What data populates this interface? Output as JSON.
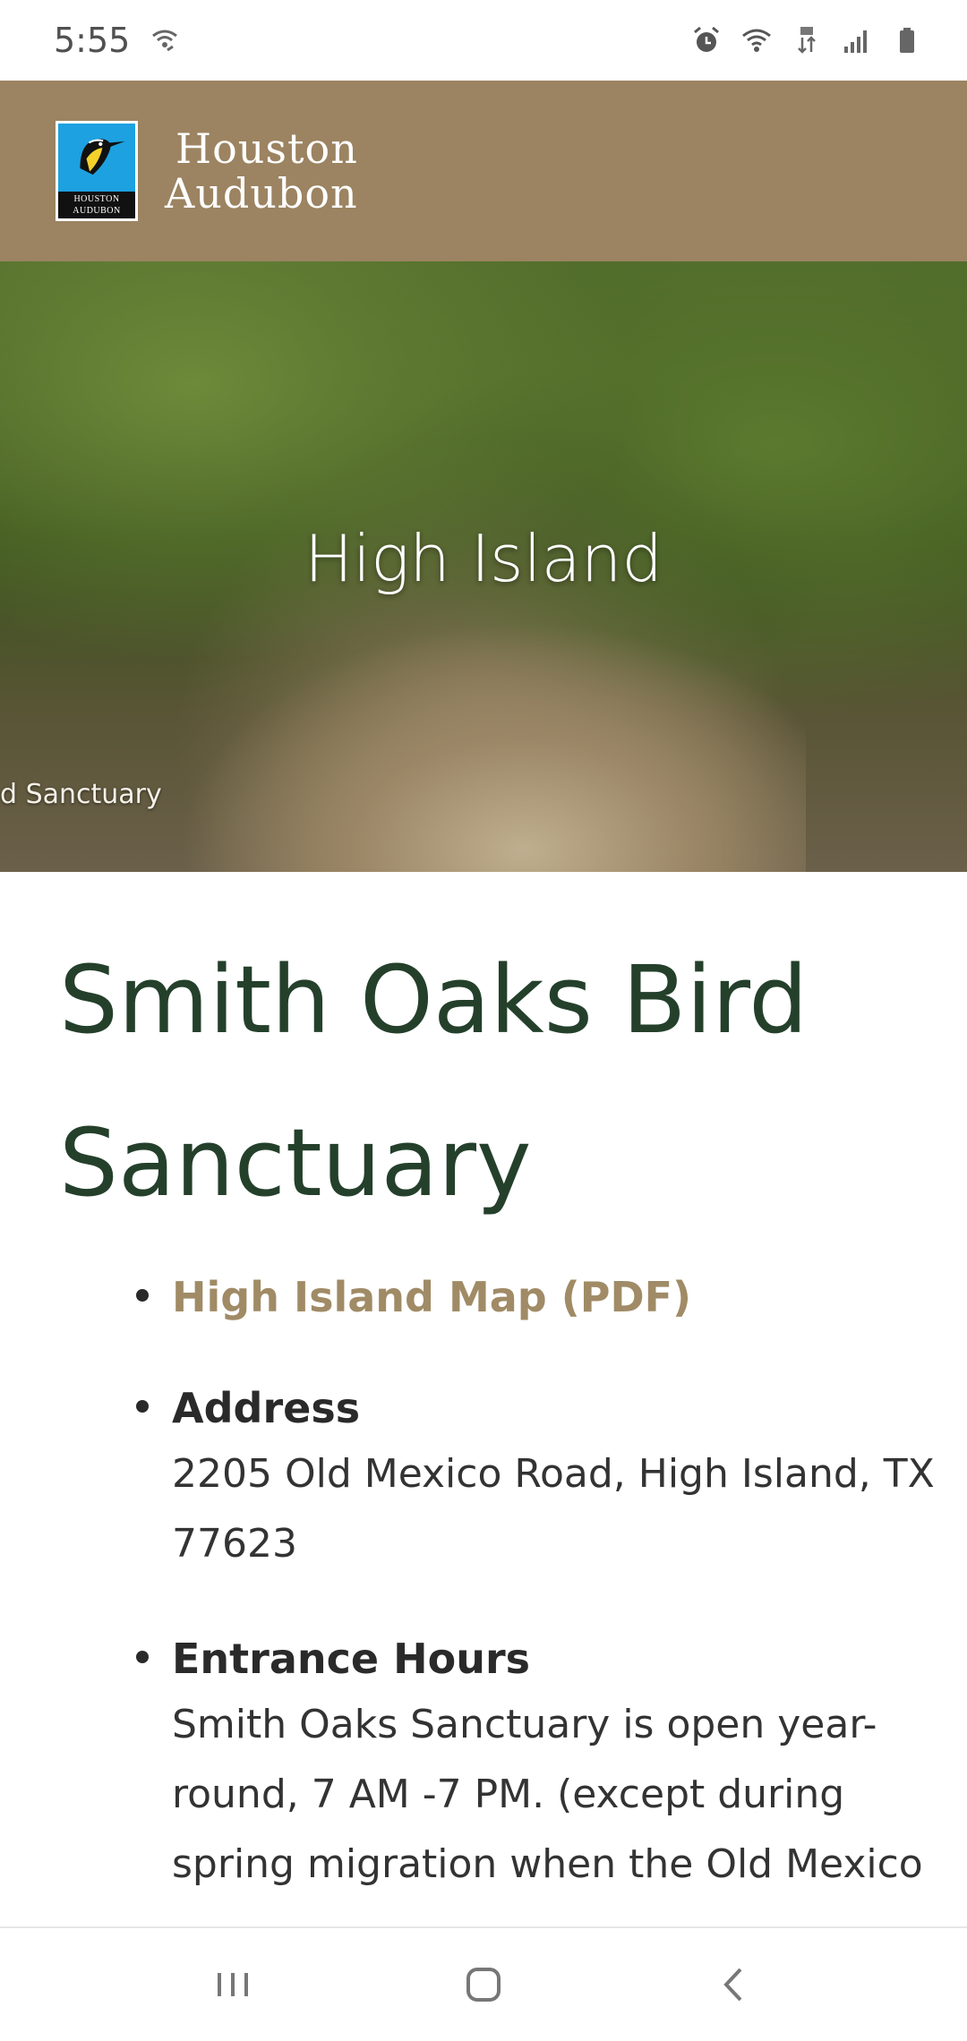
{
  "status_bar": {
    "time": "5:55"
  },
  "header": {
    "logo_line1": "Houston",
    "logo_line2": "Audubon",
    "logo_badge_top": "HOUSTON",
    "logo_badge_bottom": "AUDUBON"
  },
  "hero": {
    "title": "High Island",
    "sign_text": "d Sanctuary"
  },
  "main": {
    "title": "Smith Oaks Bird Sanctuary",
    "map_link": "High Island Map (PDF)",
    "address": {
      "heading": "Address",
      "text": "2205 Old Mexico Road, High Island, TX 77623"
    },
    "hours": {
      "heading": "Entrance Hours",
      "text": "Smith Oaks Sanctuary is open year-round, 7 AM -7 PM. (except during spring migration when the Old Mexico"
    }
  },
  "colors": {
    "header_bg": "#9c8361",
    "title_green": "#24402b",
    "link_tan": "#a08b66"
  },
  "icons": {
    "status_left": [
      "wifi-calling-icon"
    ],
    "status_right": [
      "alarm-icon",
      "wifi-icon",
      "data-4g-icon",
      "signal-icon",
      "battery-icon"
    ],
    "nav": [
      "recents-icon",
      "home-icon",
      "back-icon"
    ]
  }
}
